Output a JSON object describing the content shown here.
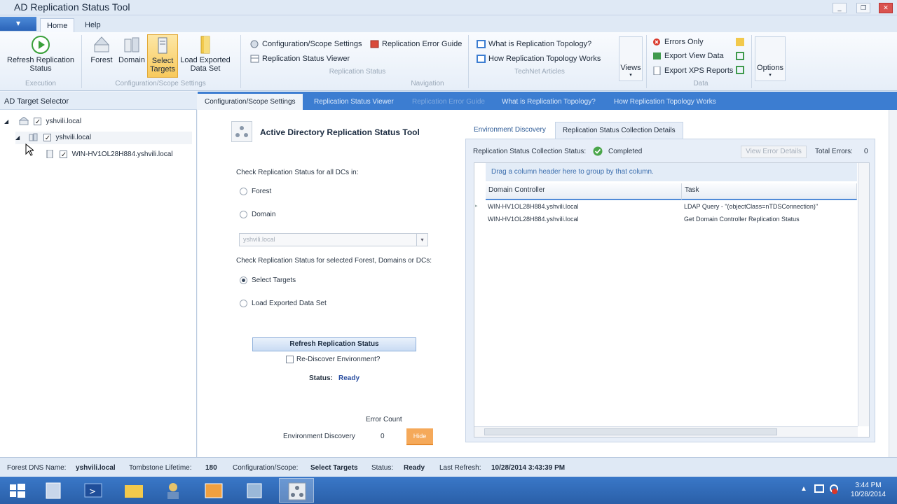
{
  "window": {
    "title": "AD Replication Status Tool",
    "controls": [
      "_",
      "❐",
      "✕"
    ]
  },
  "ribbon": {
    "tabs": [
      "Home",
      "Help"
    ],
    "execution": {
      "refresh_label_1": "Refresh Replication",
      "refresh_label_2": "Status",
      "group": "Execution"
    },
    "scope": {
      "forest": "Forest",
      "domain": "Domain",
      "select_1": "Select",
      "select_2": "Targets",
      "load_1": "Load Exported",
      "load_2": "Data Set",
      "group": "Configuration/Scope Settings"
    },
    "navigation": {
      "config_scope": "Configuration/Scope Settings",
      "status_viewer": "Replication Status Viewer",
      "error_guide": "Replication Error Guide",
      "sub_group": "Replication Status",
      "group": "Navigation"
    },
    "technet": {
      "what_is": "What is Replication Topology?",
      "how_works": "How Replication Topology Works",
      "group": "TechNet Articles"
    },
    "views": {
      "label": "Views"
    },
    "data": {
      "errors_only": "Errors Only",
      "export_view": "Export View Data",
      "export_xps": "Export XPS Reports",
      "group": "Data"
    },
    "options": {
      "label": "Options"
    }
  },
  "left_pane": {
    "header": "AD Target Selector",
    "tree": [
      {
        "label": "yshvili.local"
      },
      {
        "label": "yshvili.local"
      },
      {
        "label": "WIN-HV1OL28H884.yshvili.local"
      }
    ]
  },
  "main_tabs": [
    "Configuration/Scope Settings",
    "Replication Status Viewer",
    "Replication Error Guide",
    "What is Replication Topology?",
    "How Replication Topology Works"
  ],
  "config": {
    "title": "Active Directory Replication Status Tool",
    "check_all": "Check Replication Status for all DCs in:",
    "forest": "Forest",
    "domain": "Domain",
    "domain_combo": "yshvili.local",
    "check_selected": "Check Replication Status for selected Forest, Domains or DCs:",
    "select_targets": "Select Targets",
    "load_exported": "Load Exported Data Set",
    "refresh_button": "Refresh Replication Status",
    "rediscover": "Re-Discover Environment?",
    "status_label": "Status:",
    "status_value": "Ready",
    "error_count_label": "Error Count",
    "env_discovery": "Environment Discovery",
    "env_count": "0",
    "hide": "Hide"
  },
  "detail": {
    "tabs": [
      "Environment Discovery",
      "Replication Status Collection Details"
    ],
    "collection_label": "Replication Status Collection Status:",
    "collection_value": "Completed",
    "view_error_details": "View Error Details",
    "total_errors_label": "Total Errors:",
    "total_errors_value": "0",
    "group_hint": "Drag a column header here to group by that column.",
    "columns": [
      "Domain Controller",
      "Task"
    ],
    "rows": [
      {
        "dc": "WIN-HV1OL28H884.yshvili.local",
        "task": "LDAP Query - \"(objectClass=nTDSConnection)\""
      },
      {
        "dc": "WIN-HV1OL28H884.yshvili.local",
        "task": "Get Domain Controller Replication Status"
      }
    ]
  },
  "statusbar": {
    "forest_label": "Forest DNS Name:",
    "forest_value": "yshvili.local",
    "tomb_label": "Tombstone Lifetime:",
    "tomb_value": "180",
    "scope_label": "Configuration/Scope:",
    "scope_value": "Select Targets",
    "status_label": "Status:",
    "status_value": "Ready",
    "refresh_label": "Last Refresh:",
    "refresh_value": "10/28/2014 3:43:39 PM"
  },
  "taskbar": {
    "time": "3:44 PM",
    "date": "10/28/2014"
  },
  "colors": {
    "accent": "#3c7dd1",
    "selected": "#f8c95c",
    "hide": "#f5a95a"
  }
}
